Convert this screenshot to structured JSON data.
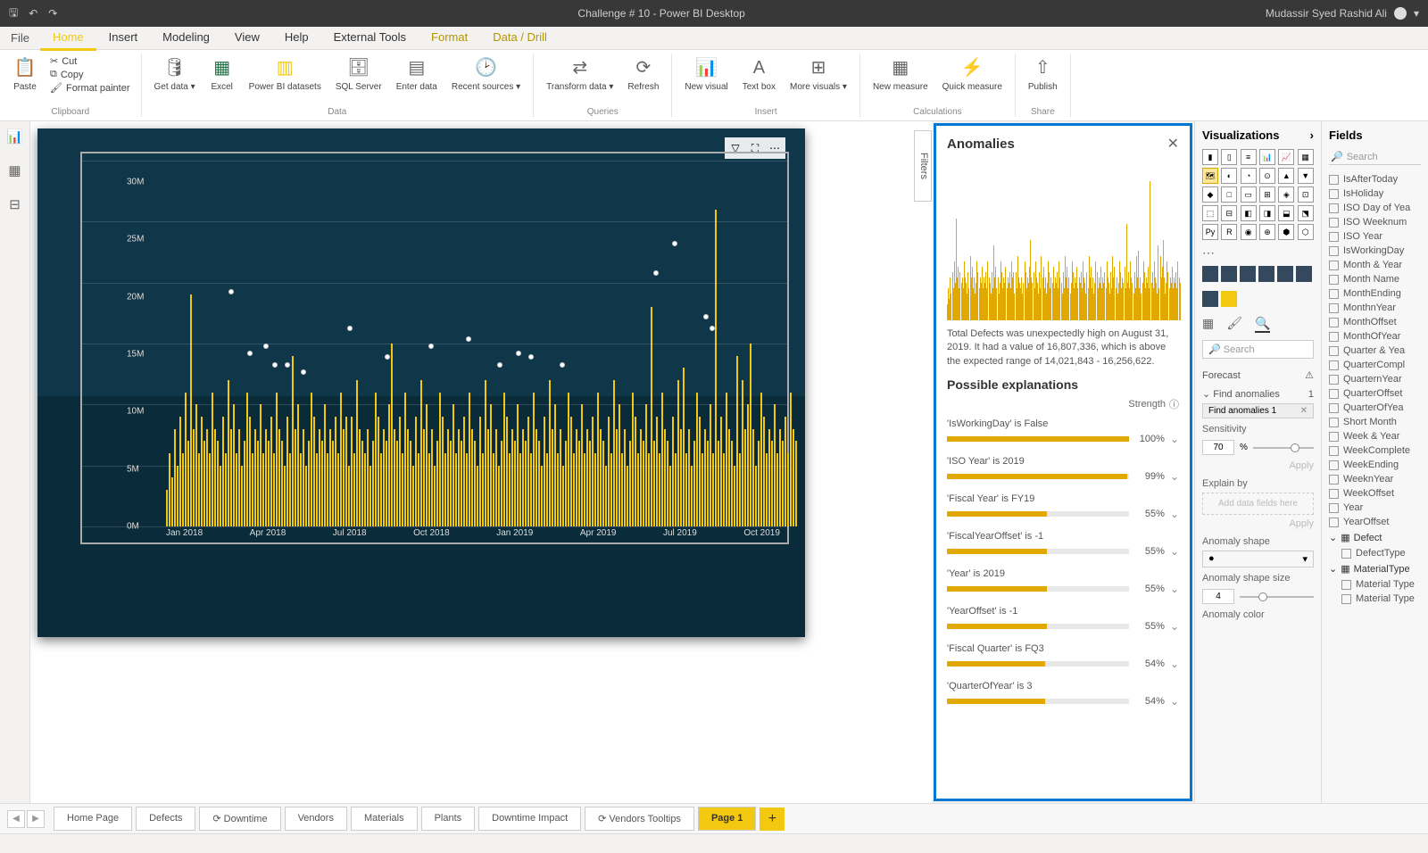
{
  "title": "Challenge # 10 - Power BI Desktop",
  "user": "Mudassir Syed Rashid Ali",
  "menu_tabs": [
    "Home",
    "Insert",
    "Modeling",
    "View",
    "Help",
    "External Tools",
    "Format",
    "Data / Drill"
  ],
  "file_label": "File",
  "ribbon": {
    "clipboard": {
      "paste": "Paste",
      "cut": "Cut",
      "copy": "Copy",
      "format_painter": "Format painter",
      "group": "Clipboard"
    },
    "data": {
      "get_data": "Get data ▾",
      "excel": "Excel",
      "powerbi": "Power BI datasets",
      "sql": "SQL Server",
      "enter": "Enter data",
      "recent": "Recent sources ▾",
      "group": "Data"
    },
    "queries": {
      "transform": "Transform data ▾",
      "refresh": "Refresh",
      "group": "Queries"
    },
    "insert": {
      "new_visual": "New visual",
      "text_box": "Text box",
      "more": "More visuals ▾",
      "group": "Insert"
    },
    "calc": {
      "new_measure": "New measure",
      "quick": "Quick measure",
      "group": "Calculations"
    },
    "share": {
      "publish": "Publish",
      "group": "Share"
    }
  },
  "filters_label": "Filters",
  "anomalies": {
    "title": "Anomalies",
    "insight": "Total Defects was unexpectedly high on August 31, 2019. It had a value of 16,807,336, which is above the expected range of 14,021,843 - 16,256,622.",
    "explanations_title": "Possible explanations",
    "strength_label": "Strength",
    "explanations": [
      {
        "label": "'IsWorkingDay' is False",
        "pct": "100%",
        "fill": 100
      },
      {
        "label": "'ISO Year' is 2019",
        "pct": "99%",
        "fill": 99
      },
      {
        "label": "'Fiscal Year' is FY19",
        "pct": "55%",
        "fill": 55
      },
      {
        "label": "'FiscalYearOffset' is -1",
        "pct": "55%",
        "fill": 55
      },
      {
        "label": "'Year' is 2019",
        "pct": "55%",
        "fill": 55
      },
      {
        "label": "'YearOffset' is -1",
        "pct": "55%",
        "fill": 55
      },
      {
        "label": "'Fiscal Quarter' is FQ3",
        "pct": "54%",
        "fill": 54
      },
      {
        "label": "'QuarterOfYear' is 3",
        "pct": "54%",
        "fill": 54
      }
    ]
  },
  "viz": {
    "title": "Visualizations",
    "search_placeholder": "Search",
    "forecast": "Forecast",
    "find_anomalies": "Find anomalies",
    "find_anomalies_count": "1",
    "chip": "Find anomalies 1",
    "sensitivity": "Sensitivity",
    "sensitivity_value": "70",
    "sensitivity_unit": "%",
    "apply": "Apply",
    "explain_by": "Explain by",
    "drop_hint": "Add data fields here",
    "shape": "Anomaly shape",
    "shape_val": "●",
    "shape_size": "Anomaly shape size",
    "shape_size_val": "4",
    "color": "Anomaly color"
  },
  "fields": {
    "title": "Fields",
    "search": "Search",
    "items": [
      "IsAfterToday",
      "IsHoliday",
      "ISO Day of Yea",
      "ISO Weeknum",
      "ISO Year",
      "IsWorkingDay",
      "Month & Year",
      "Month Name",
      "MonthEnding",
      "MonthnYear",
      "MonthOffset",
      "MonthOfYear",
      "Quarter & Yea",
      "QuarterCompl",
      "QuarternYear",
      "QuarterOffset",
      "QuarterOfYea",
      "Short Month",
      "Week & Year",
      "WeekComplete",
      "WeekEnding",
      "WeeknYear",
      "WeekOffset",
      "Year",
      "YearOffset"
    ],
    "groups": [
      {
        "name": "Defect",
        "items": [
          "DefectType"
        ]
      },
      {
        "name": "MaterialType",
        "items": [
          "Material Type",
          "Material Type"
        ]
      }
    ]
  },
  "tabs": [
    "Home Page",
    "Defects",
    "Downtime",
    "Vendors",
    "Materials",
    "Plants",
    "Downtime Impact",
    "Vendors Tooltips",
    "Page 1"
  ],
  "tab_icons": {
    "downtime": "⟳",
    "vendors_tooltips": "⟳"
  },
  "chart_data": {
    "type": "bar",
    "title": "",
    "ylabel": "",
    "y_ticks": [
      "30M",
      "25M",
      "20M",
      "15M",
      "10M",
      "5M",
      "0M"
    ],
    "x_ticks": [
      "Jan 2018",
      "Apr 2018",
      "Jul 2018",
      "Oct 2018",
      "Jan 2019",
      "Apr 2019",
      "Jul 2019",
      "Oct 2019"
    ],
    "ylim": [
      0,
      30
    ],
    "series": [
      {
        "name": "Total Defects",
        "units": "M"
      }
    ],
    "values_M": [
      3,
      6,
      4,
      8,
      5,
      9,
      6,
      11,
      7,
      19,
      8,
      10,
      6,
      9,
      7,
      8,
      6,
      11,
      8,
      7,
      5,
      9,
      6,
      12,
      8,
      10,
      6,
      8,
      5,
      7,
      11,
      9,
      6,
      8,
      7,
      10,
      6,
      8,
      7,
      9,
      6,
      11,
      8,
      7,
      5,
      9,
      6,
      14,
      8,
      10,
      6,
      8,
      5,
      7,
      11,
      9,
      6,
      8,
      7,
      10,
      6,
      8,
      7,
      9,
      6,
      11,
      8,
      9,
      5,
      9,
      6,
      12,
      8,
      7,
      6,
      8,
      5,
      7,
      11,
      9,
      6,
      8,
      7,
      10,
      15,
      8,
      7,
      9,
      6,
      11,
      8,
      7,
      5,
      9,
      6,
      12,
      8,
      10,
      6,
      8,
      5,
      7,
      11,
      9,
      6,
      8,
      7,
      10,
      6,
      8,
      7,
      9,
      6,
      11,
      8,
      7,
      5,
      9,
      6,
      12,
      8,
      10,
      6,
      8,
      5,
      7,
      11,
      9,
      6,
      8,
      7,
      10,
      6,
      8,
      7,
      9,
      6,
      11,
      8,
      7,
      5,
      9,
      6,
      12,
      8,
      10,
      6,
      8,
      5,
      7,
      11,
      9,
      6,
      8,
      7,
      10,
      6,
      8,
      7,
      9,
      6,
      11,
      8,
      7,
      5,
      9,
      6,
      12,
      8,
      10,
      6,
      8,
      5,
      7,
      11,
      9,
      6,
      8,
      7,
      10,
      6,
      18,
      7,
      9,
      6,
      11,
      8,
      7,
      5,
      9,
      6,
      12,
      8,
      13,
      6,
      8,
      5,
      7,
      11,
      9,
      6,
      8,
      7,
      10,
      6,
      26,
      7,
      9,
      6,
      11,
      8,
      7,
      5,
      14,
      6,
      12,
      8,
      10,
      15,
      8,
      5,
      7,
      11,
      9,
      6,
      8,
      7,
      10,
      6,
      8,
      7,
      9,
      6,
      11,
      8,
      7
    ],
    "anomaly_markers": [
      {
        "x_pct": 10,
        "y_pct": 35
      },
      {
        "x_pct": 13,
        "y_pct": 52
      },
      {
        "x_pct": 15.5,
        "y_pct": 50
      },
      {
        "x_pct": 17,
        "y_pct": 55
      },
      {
        "x_pct": 19,
        "y_pct": 55
      },
      {
        "x_pct": 21.5,
        "y_pct": 57
      },
      {
        "x_pct": 29,
        "y_pct": 45
      },
      {
        "x_pct": 35,
        "y_pct": 53
      },
      {
        "x_pct": 42,
        "y_pct": 50
      },
      {
        "x_pct": 48,
        "y_pct": 48
      },
      {
        "x_pct": 53,
        "y_pct": 55
      },
      {
        "x_pct": 56,
        "y_pct": 52
      },
      {
        "x_pct": 58,
        "y_pct": 53
      },
      {
        "x_pct": 63,
        "y_pct": 55
      },
      {
        "x_pct": 78,
        "y_pct": 30
      },
      {
        "x_pct": 81,
        "y_pct": 22
      },
      {
        "x_pct": 86,
        "y_pct": 42
      },
      {
        "x_pct": 87,
        "y_pct": 45
      }
    ]
  }
}
